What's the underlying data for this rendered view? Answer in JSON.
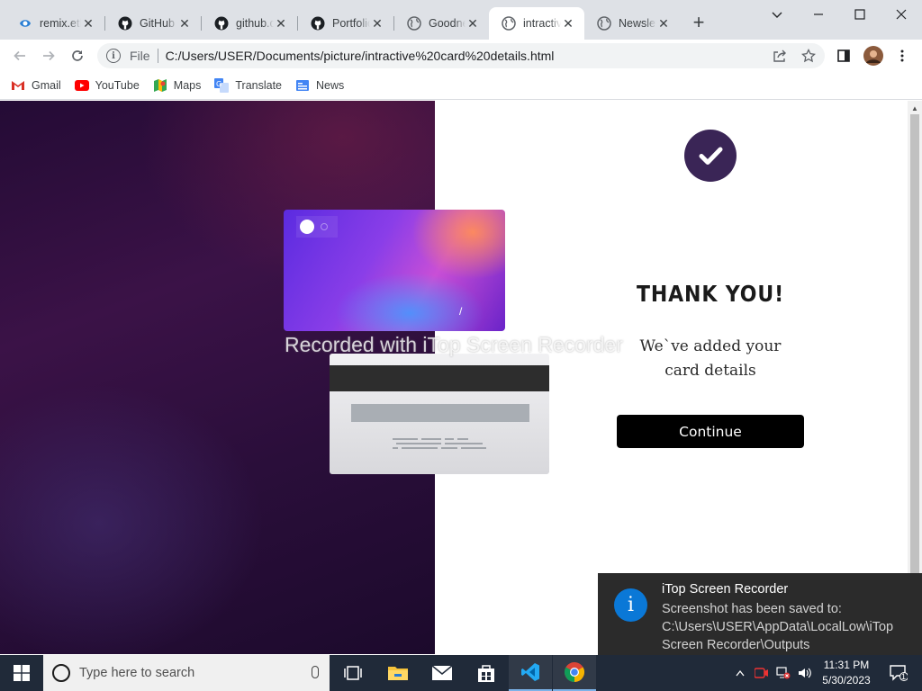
{
  "browser": {
    "tabs": [
      {
        "title": "remix.eth",
        "icon": "remix-icon",
        "active": false
      },
      {
        "title": "GitHub",
        "icon": "github-icon",
        "active": false
      },
      {
        "title": "github.com",
        "icon": "github-icon",
        "active": false
      },
      {
        "title": "Portfolio",
        "icon": "github-icon",
        "active": false
      },
      {
        "title": "Goodness",
        "icon": "globe-icon",
        "active": false
      },
      {
        "title": "intractive",
        "icon": "globe-icon",
        "active": true
      },
      {
        "title": "Newsletter",
        "icon": "globe-icon",
        "active": false
      }
    ],
    "omnibox": {
      "scheme_label": "File",
      "url": "C:/Users/USER/Documents/picture/intractive%20card%20details.html"
    },
    "bookmarks": [
      {
        "label": "Gmail",
        "icon": "gmail-icon"
      },
      {
        "label": "YouTube",
        "icon": "youtube-icon"
      },
      {
        "label": "Maps",
        "icon": "maps-icon"
      },
      {
        "label": "Translate",
        "icon": "translate-icon"
      },
      {
        "label": "News",
        "icon": "news-icon"
      }
    ]
  },
  "page": {
    "watermark": "Recorded with iTop Screen Recorder",
    "thank_you_title": "THANK YOU!",
    "thank_you_message": "We`ve added your card details",
    "continue_label": "Continue",
    "card_front_mark": "/",
    "colors": {
      "badge": "#3a2556",
      "button": "#000000"
    }
  },
  "notification": {
    "title": "iTop Screen Recorder",
    "body": "Screenshot has been saved to: C:\\Users\\USER\\AppData\\LocalLow\\iTop Screen Recorder\\Outputs",
    "icon_glyph": "i",
    "badge_count": "1"
  },
  "taskbar": {
    "search_placeholder": "Type here to search",
    "time": "11:31 PM",
    "date": "5/30/2023"
  }
}
